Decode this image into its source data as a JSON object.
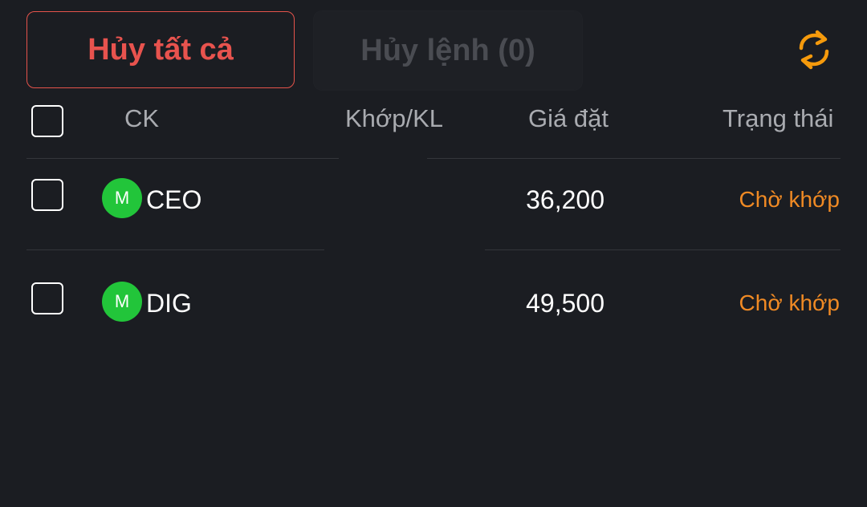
{
  "toolbar": {
    "cancel_all_label": "Hủy tất cả",
    "cancel_orders_label": "Hủy lệnh (0)",
    "refresh_icon": "refresh-icon"
  },
  "table": {
    "headers": {
      "symbol": "CK",
      "matched_volume": "Khớp/KL",
      "order_price": "Giá đặt",
      "status": "Trạng thái"
    },
    "rows": [
      {
        "badge": "M",
        "symbol": "CEO",
        "matched_volume": "",
        "order_price": "36,200",
        "status": "Chờ khớp"
      },
      {
        "badge": "M",
        "symbol": "DIG",
        "matched_volume": "",
        "order_price": "49,500",
        "status": "Chờ khớp"
      }
    ]
  },
  "colors": {
    "background": "#1b1d22",
    "danger": "#e8534e",
    "status_pending": "#f08a24",
    "badge_green": "#22c53a"
  }
}
